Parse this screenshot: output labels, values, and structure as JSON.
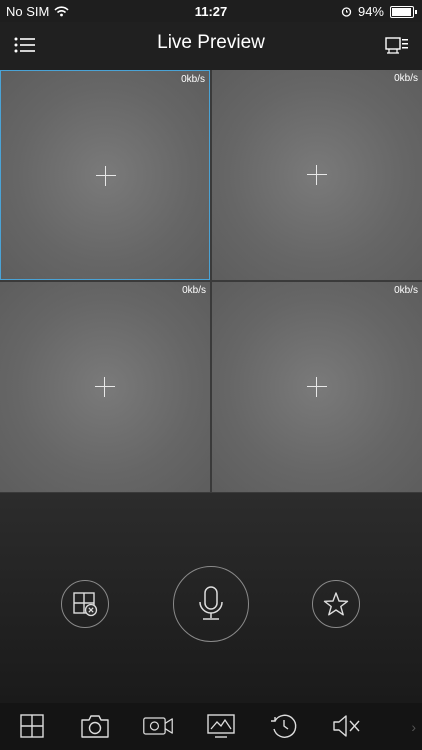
{
  "status_bar": {
    "carrier": "No SIM",
    "time": "11:27",
    "battery": "94%",
    "battery_level": 0.94
  },
  "nav": {
    "title": "Live Preview",
    "left_icon": "menu-list-icon",
    "right_icon": "device-list-icon"
  },
  "channels": [
    {
      "rate": "0kb/s",
      "selected": true
    },
    {
      "rate": "0kb/s",
      "selected": false
    },
    {
      "rate": "0kb/s",
      "selected": false
    },
    {
      "rate": "0kb/s",
      "selected": false
    }
  ],
  "controls": {
    "left": "close-window-icon",
    "center": "microphone-icon",
    "right": "star-icon"
  },
  "toolbar": {
    "items": [
      "split-screen-icon",
      "snapshot-icon",
      "record-icon",
      "image-quality-icon",
      "playback-icon",
      "mute-icon"
    ],
    "chevron": "›"
  },
  "colors": {
    "accent": "#4aa3d6",
    "background": "#1b1b1b"
  }
}
